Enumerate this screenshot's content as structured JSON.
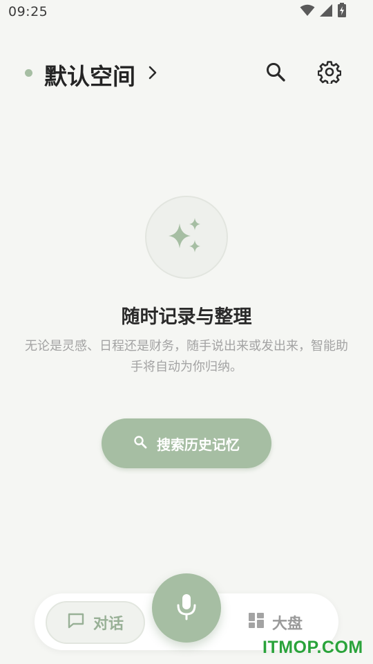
{
  "status_bar": {
    "time": "09:25",
    "icons": [
      "wifi-icon",
      "cellular-signal-icon",
      "battery-charging-icon"
    ]
  },
  "header": {
    "space_name": "默认空间",
    "icons": [
      "chevron-right-icon",
      "search-icon",
      "gear-icon"
    ]
  },
  "empty_state": {
    "icon": "sparkles-icon",
    "title": "随时记录与整理",
    "description": "无论是灵感、日程还是财务，随手说出来或发出来，智能助手将自动为你归纳。"
  },
  "search_history_button": {
    "label": "搜索历史记忆",
    "icon": "search-icon"
  },
  "bottom_nav": {
    "chat_label": "对话",
    "chat_icon": "chat-bubble-icon",
    "mic_icon": "microphone-icon",
    "board_label": "大盘",
    "board_icon": "dashboard-icon"
  },
  "watermark": "ITMOP.COM",
  "colors": {
    "accent": "#a6bea3",
    "background": "#f5f6f3",
    "title_text": "#242424",
    "muted_text": "#a3a3a3",
    "watermark": "#2aa33b"
  }
}
